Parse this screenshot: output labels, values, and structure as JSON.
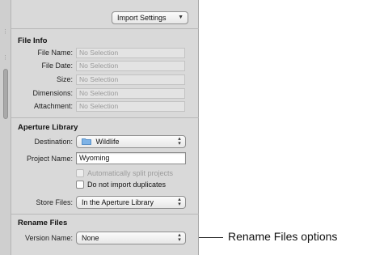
{
  "toolbar": {
    "import_settings_label": "Import Settings"
  },
  "file_info": {
    "title": "File Info",
    "rows": [
      {
        "label": "File Name:",
        "value": "No Selection"
      },
      {
        "label": "File Date:",
        "value": "No Selection"
      },
      {
        "label": "Size:",
        "value": "No Selection"
      },
      {
        "label": "Dimensions:",
        "value": "No Selection"
      },
      {
        "label": "Attachment:",
        "value": "No Selection"
      }
    ]
  },
  "aperture_library": {
    "title": "Aperture Library",
    "destination_label": "Destination:",
    "destination_value": "Wildlife",
    "destination_icon": "folder-icon",
    "project_name_label": "Project Name:",
    "project_name_value": "Wyoming",
    "split_projects_label": "Automatically split projects",
    "split_projects_checked": false,
    "split_projects_enabled": false,
    "no_duplicates_label": "Do not import duplicates",
    "no_duplicates_checked": false,
    "store_files_label": "Store Files:",
    "store_files_value": "In the Aperture Library"
  },
  "rename_files": {
    "title": "Rename Files",
    "version_name_label": "Version Name:",
    "version_name_value": "None"
  },
  "callout": {
    "text": "Rename Files options"
  },
  "colors": {
    "panel_bg": "#d9d9d9",
    "field_disabled_bg": "#e3e3e3",
    "text_disabled": "#9a9a9a"
  }
}
